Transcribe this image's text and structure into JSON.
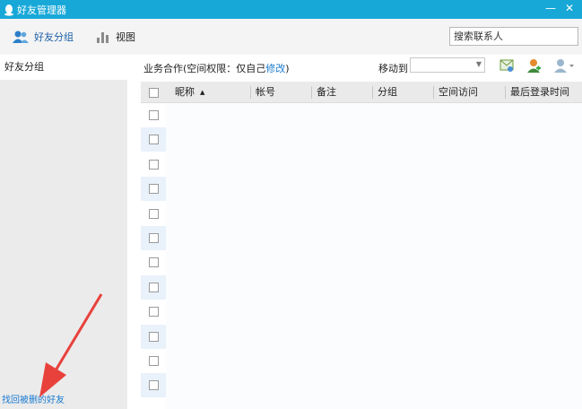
{
  "window": {
    "title": "好友管理器",
    "minimize_glyph": "—",
    "close_glyph": "✕"
  },
  "toolbar": {
    "friend_group_label": "好友分组",
    "view_label": "视图",
    "search_placeholder": "搜索联系人"
  },
  "sidebar": {
    "header": "好友分组",
    "find_deleted_link": "找回被删的好友"
  },
  "content": {
    "group_title": "业务合作(空间权限：仅自己",
    "group_edit_link": "修改",
    "group_close": ")",
    "move_to_label": "移动到",
    "move_to_value": ""
  },
  "table": {
    "columns": [
      "昵称",
      "帐号",
      "备注",
      "分组",
      "空间访问",
      "最后登录时间"
    ],
    "sort_indicator": "▲",
    "row_count": 12
  },
  "colors": {
    "titlebar": "#17a8d8",
    "link": "#1b7bd0",
    "arrow": "#e8413c",
    "row_alt": "#e9f2fb"
  },
  "icons": [
    "qq-penguin-icon",
    "friends-icon",
    "bar-chart-icon",
    "send-mail-icon",
    "add-user-icon",
    "user-settings-icon"
  ]
}
